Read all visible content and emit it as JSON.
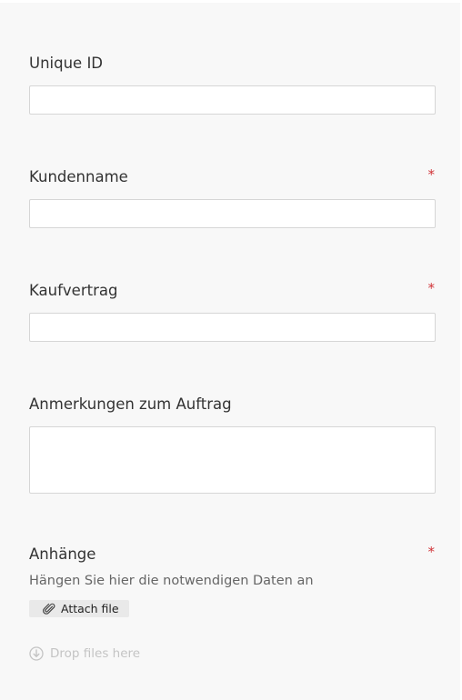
{
  "form": {
    "fields": [
      {
        "label": "Unique ID",
        "required": false,
        "value": ""
      },
      {
        "label": "Kundenname",
        "required": true,
        "value": ""
      },
      {
        "label": "Kaufvertrag",
        "required": true,
        "value": ""
      },
      {
        "label": "Anmerkungen zum Auftrag",
        "required": false,
        "value": ""
      }
    ],
    "attachments": {
      "label": "Anhänge",
      "required": true,
      "hint": "Hängen Sie hier die notwendigen Daten an",
      "attach_label": "Attach file",
      "drop_label": "Drop files here"
    },
    "required_marker": "*"
  },
  "icons": {
    "attach": "paperclip-icon",
    "drop": "download-circle-icon"
  },
  "colors": {
    "panel_background": "#f8f8f8",
    "input_border": "#d6d6d6",
    "required": "#d13438",
    "label": "#333333",
    "hint": "#666666",
    "drop_text": "#c4c4c4",
    "attach_button": "#e9e9e9"
  }
}
